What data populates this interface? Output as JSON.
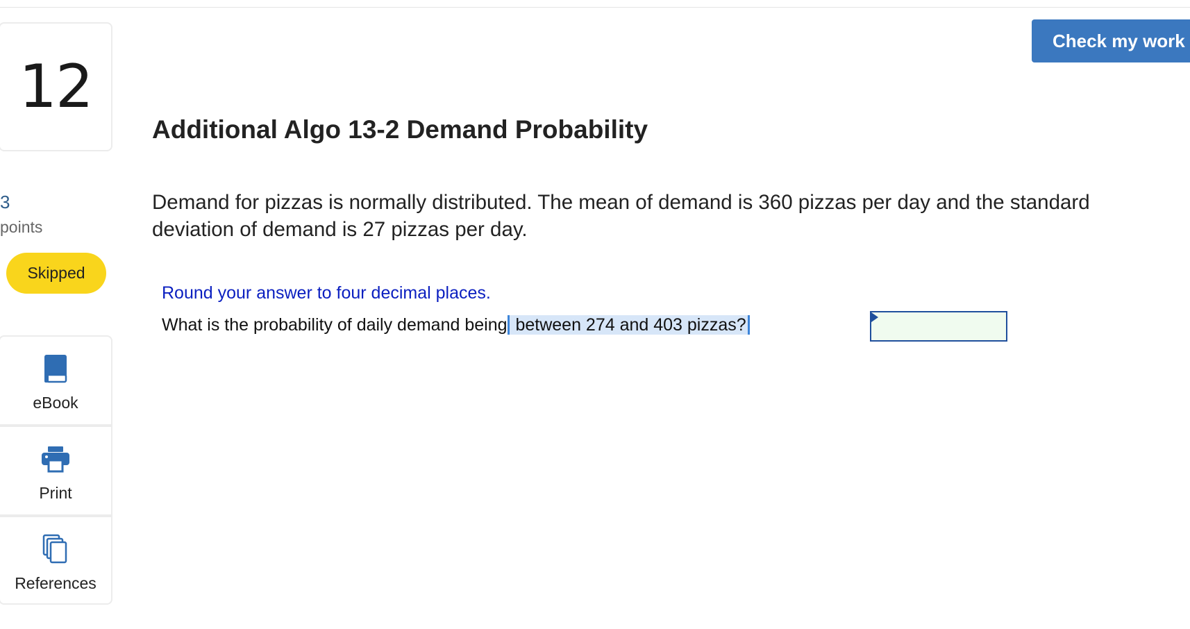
{
  "question": {
    "number": "12",
    "points_value": "3",
    "points_label": "points",
    "status": "Skipped",
    "title": "Additional Algo 13-2 Demand Probability",
    "stem": "Demand for pizzas is normally distributed. The mean of demand is 360 pizzas per day and the standard deviation of demand is 27 pizzas per day.",
    "instruction": "Round your answer to four decimal places.",
    "prompt_prefix": "What is the probability of daily demand being",
    "prompt_highlight": " between 274 and 403 pizzas?",
    "answer_value": ""
  },
  "tools": {
    "ebook": "eBook",
    "print": "Print",
    "references": "References"
  },
  "actions": {
    "check_label": "Check my work"
  },
  "colors": {
    "accent": "#3b78bf",
    "status_badge": "#f9d51c",
    "instruction_text": "#0b1fc0",
    "selection_highlight": "#d7e6f8",
    "answer_field_bg": "#f0fbef"
  },
  "icons": {
    "ebook": "book-icon",
    "print": "printer-icon",
    "references": "copy-pages-icon"
  }
}
